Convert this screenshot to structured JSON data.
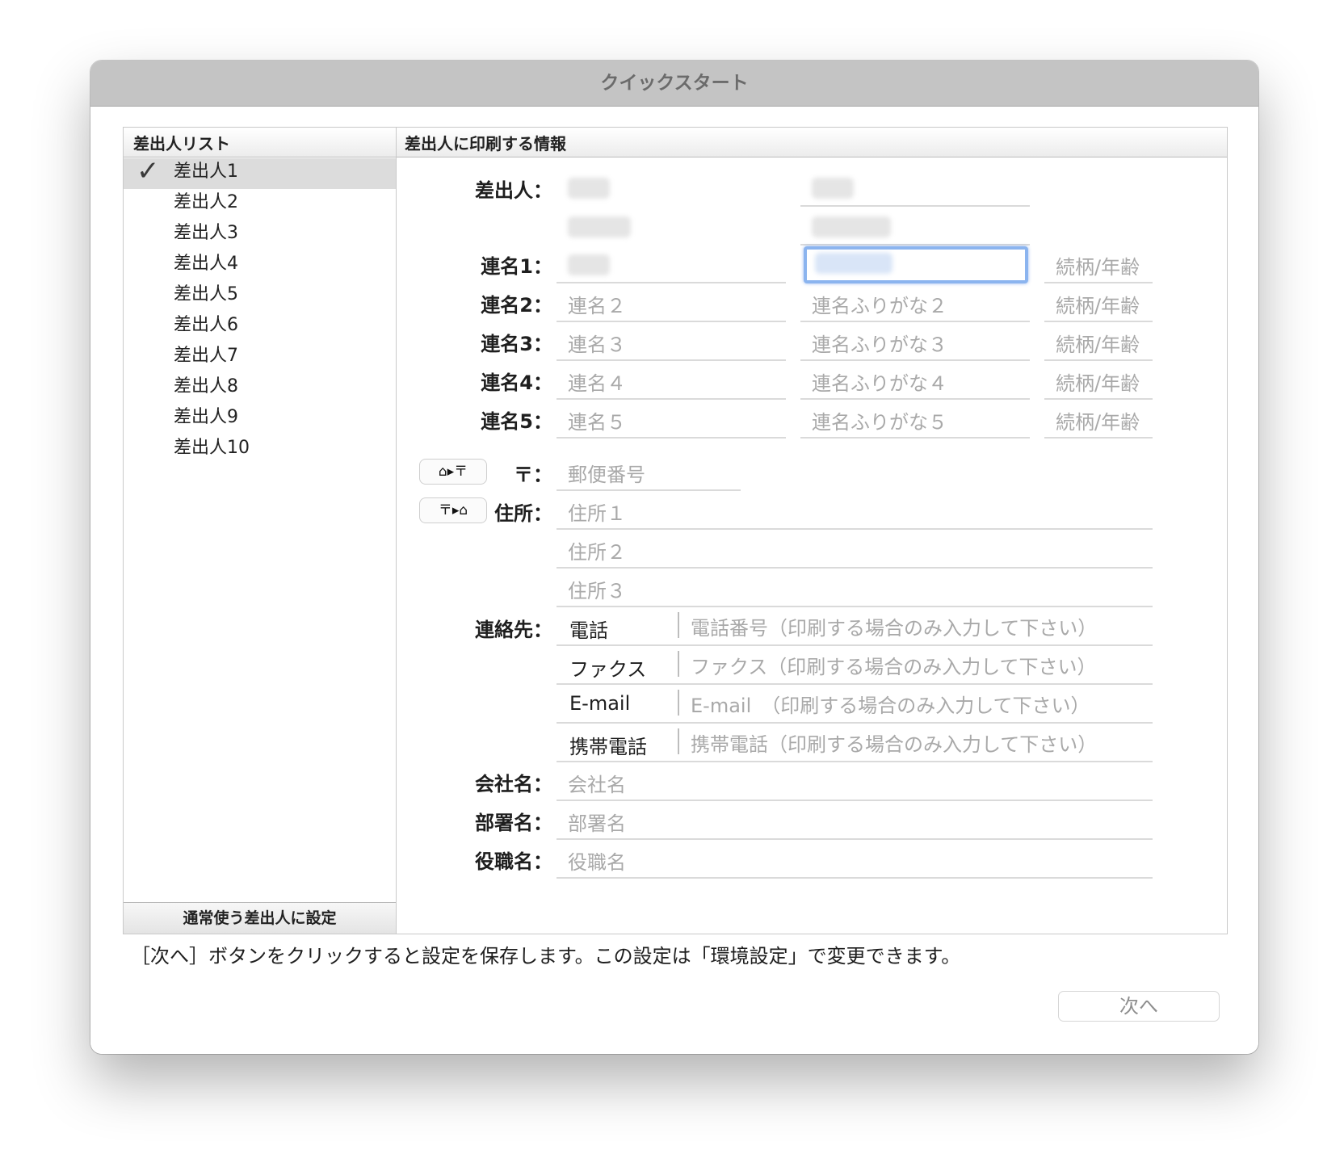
{
  "window": {
    "title": "クイックスタート"
  },
  "sender_list": {
    "header": "差出人リスト",
    "items": [
      "差出人1",
      "差出人2",
      "差出人3",
      "差出人4",
      "差出人5",
      "差出人6",
      "差出人7",
      "差出人8",
      "差出人9",
      "差出人10"
    ],
    "selected_index": 0,
    "default_button": "通常使う差出人に設定"
  },
  "form": {
    "header": "差出人に印刷する情報",
    "sender_label": "差出人：",
    "renmei": [
      {
        "label": "連名1：",
        "name_placeholder": "",
        "kana_placeholder": "",
        "relation_placeholder": "続柄/年齢"
      },
      {
        "label": "連名2：",
        "name_placeholder": "連名２",
        "kana_placeholder": "連名ふりがな２",
        "relation_placeholder": "続柄/年齢"
      },
      {
        "label": "連名3：",
        "name_placeholder": "連名３",
        "kana_placeholder": "連名ふりがな３",
        "relation_placeholder": "続柄/年齢"
      },
      {
        "label": "連名4：",
        "name_placeholder": "連名４",
        "kana_placeholder": "連名ふりがな４",
        "relation_placeholder": "続柄/年齢"
      },
      {
        "label": "連名5：",
        "name_placeholder": "連名５",
        "kana_placeholder": "連名ふりがな５",
        "relation_placeholder": "続柄/年齢"
      }
    ],
    "postal_label": "〒：",
    "postal_placeholder": "郵便番号",
    "address_to_postal_button": "⌂▸〒",
    "postal_to_address_button": "〒▸⌂",
    "address_label": "住所：",
    "address_placeholders": [
      "住所１",
      "住所２",
      "住所３"
    ],
    "contact_label": "連絡先：",
    "contacts": [
      {
        "type": "電話",
        "placeholder": "電話番号（印刷する場合のみ入力して下さい）"
      },
      {
        "type": "ファクス",
        "placeholder": "ファクス（印刷する場合のみ入力して下さい）"
      },
      {
        "type": "E-mail",
        "placeholder": "E-mail　（印刷する場合のみ入力して下さい）"
      },
      {
        "type": "携帯電話",
        "placeholder": "携帯電話（印刷する場合のみ入力して下さい）"
      }
    ],
    "company_label": "会社名：",
    "company_placeholder": "会社名",
    "department_label": "部署名：",
    "department_placeholder": "部署名",
    "position_label": "役職名：",
    "position_placeholder": "役職名"
  },
  "footer": {
    "note": "［次へ］ボタンをクリックすると設定を保存します。この設定は「環境設定」で変更できます。",
    "next_button": "次へ"
  }
}
